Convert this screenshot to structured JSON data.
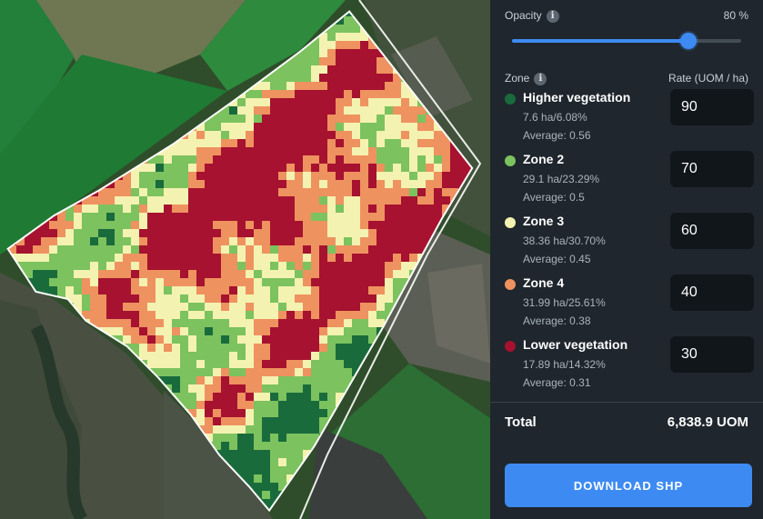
{
  "colors": {
    "higher": "#1a6b3c",
    "zone2": "#7cc25e",
    "zone3": "#f4f2b0",
    "zone4": "#ee9260",
    "lower": "#a6122f",
    "accent": "#3d8bf2"
  },
  "opacity": {
    "label": "Opacity",
    "info_icon": "i",
    "value_text": "80 %",
    "value": 80
  },
  "table": {
    "zone_header": "Zone",
    "zone_info_icon": "i",
    "rate_header": "Rate (UOM / ha)"
  },
  "zones": [
    {
      "name": "Higher vegetation",
      "area": "7.6 ha/6.08%",
      "average": "Average: 0.56",
      "rate": "90",
      "color": "#1a6b3c"
    },
    {
      "name": "Zone 2",
      "area": "29.1 ha/23.29%",
      "average": "Average: 0.5",
      "rate": "70",
      "color": "#7cc25e"
    },
    {
      "name": "Zone 3",
      "area": "38.36 ha/30.70%",
      "average": "Average: 0.45",
      "rate": "60",
      "color": "#f4f2b0"
    },
    {
      "name": "Zone 4",
      "area": "31.99 ha/25.61%",
      "average": "Average: 0.38",
      "rate": "40",
      "color": "#ee9260"
    },
    {
      "name": "Lower vegetation",
      "area": "17.89 ha/14.32%",
      "average": "Average: 0.31",
      "rate": "30",
      "color": "#a6122f"
    }
  ],
  "total": {
    "label": "Total",
    "value": "6,838.9 UOM"
  },
  "download": {
    "label": "DOWNLOAD SHP"
  }
}
